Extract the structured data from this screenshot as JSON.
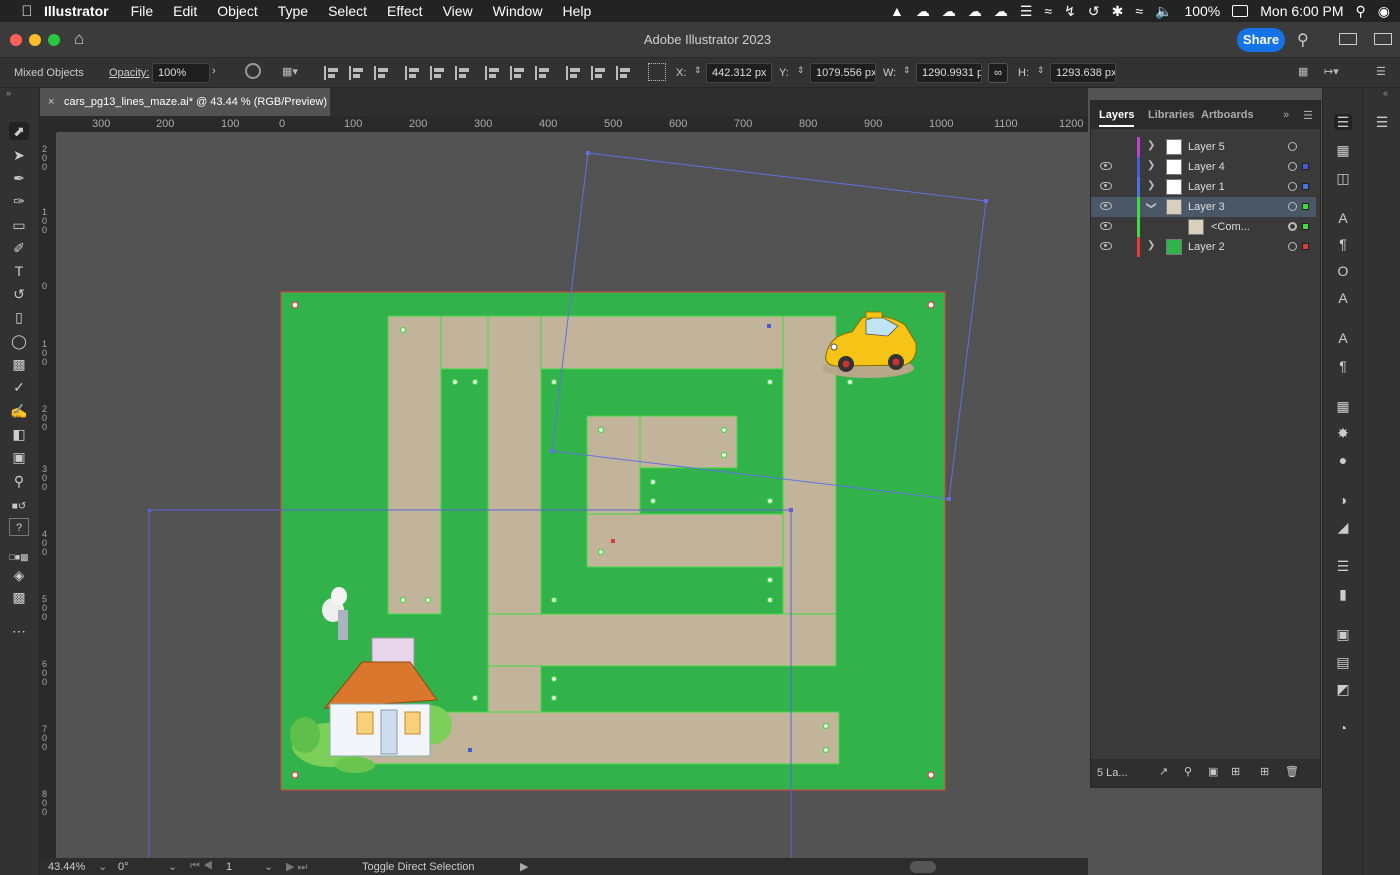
{
  "menubar": {
    "apple": "",
    "app_name": "Illustrator",
    "items": [
      "File",
      "Edit",
      "Object",
      "Type",
      "Select",
      "Effect",
      "View",
      "Window",
      "Help"
    ],
    "battery": "100%",
    "clock": "Mon 6:00 PM"
  },
  "titlebar": {
    "title": "Adobe Illustrator 2023",
    "share_label": "Share"
  },
  "controlbar": {
    "selection_label": "Mixed Objects",
    "opacity_label": "Opacity:",
    "opacity_value": "100%",
    "x_label": "X:",
    "x_value": "442.312 px",
    "y_label": "Y:",
    "y_value": "1079.556 px",
    "w_label": "W:",
    "w_value": "1290.9931 p",
    "h_label": "H:",
    "h_value": "1293.638 px"
  },
  "document": {
    "tab_title": "cars_pg13_lines_maze.ai* @ 43.44 % (RGB/Preview)",
    "close_glyph": "×"
  },
  "rulers": {
    "h_ticks": [
      "300",
      "200",
      "100",
      "0",
      "100",
      "200",
      "300",
      "400",
      "500",
      "600",
      "700",
      "800",
      "900",
      "1000",
      "1100",
      "1200"
    ],
    "v_ticks": [
      "200",
      "100",
      "0",
      "100",
      "200",
      "300",
      "400",
      "500",
      "600",
      "700",
      "800"
    ]
  },
  "status": {
    "zoom": "43.44%",
    "rotation": "0°",
    "artboard": "1",
    "tool_hint": "Toggle Direct Selection"
  },
  "layers_panel": {
    "tabs": [
      "Layers",
      "Libraries",
      "Artboards"
    ],
    "layers": [
      {
        "name": "Layer 5",
        "color": "#c040d0",
        "visible": false,
        "selected": false
      },
      {
        "name": "Layer 4",
        "color": "#4a5ad6",
        "visible": true,
        "selected": false
      },
      {
        "name": "Layer 1",
        "color": "#4a74e0",
        "visible": true,
        "selected": false
      },
      {
        "name": "Layer 3",
        "color": "#3fdc3f",
        "visible": true,
        "selected": true
      },
      {
        "name": "<Com...",
        "color": "#3fdc3f",
        "visible": true,
        "selected": false
      },
      {
        "name": "Layer 2",
        "color": "#e03b3b",
        "visible": true,
        "selected": false
      }
    ],
    "footer_count": "5 La..."
  },
  "colors": {
    "maze_green": "#31b24a",
    "maze_path": "#c2b49b",
    "accent": "#1473e6"
  }
}
